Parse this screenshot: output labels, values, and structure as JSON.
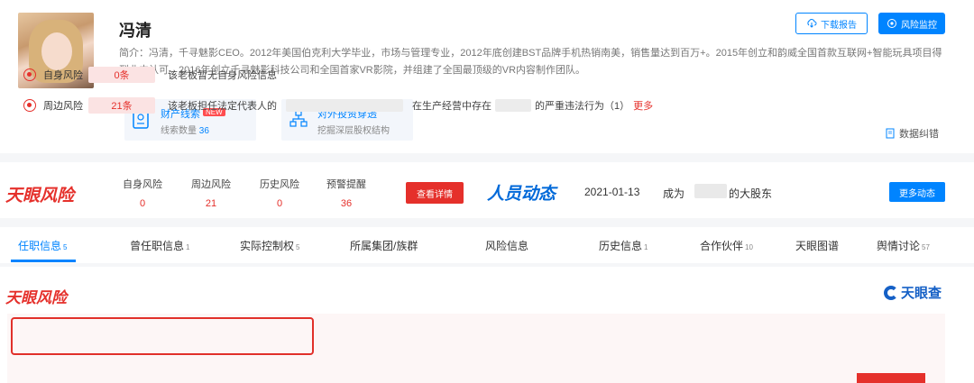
{
  "profile": {
    "name": "冯清",
    "bio": "简介：冯清，千寻魅影CEO。2012年美国伯克利大学毕业，市场与管理专业，2012年底创建BST品牌手机热销南美，销售量达到百万+。2015年创立和韵威全国首款互联网+智能玩具项目得到业内认可。2016年创立千寻魅影科技公司和全国首家VR影院，并组建了全国最顶级的VR内容制作团队。",
    "btn_download": "下载报告",
    "btn_monitor": "风险监控",
    "features": [
      {
        "title": "财产线索",
        "badge": "NEW",
        "sub_prefix": "线索数量",
        "sub_value": "36",
        "icon": "doc-icon"
      },
      {
        "title": "对外投资穿透",
        "sub": "挖掘深层股权结构",
        "icon": "network-icon"
      }
    ],
    "data_correction": "数据纠错"
  },
  "risk_bar": {
    "logo": "天眼风险",
    "stats": [
      {
        "label": "自身风险",
        "value": "0"
      },
      {
        "label": "周边风险",
        "value": "21"
      },
      {
        "label": "历史风险",
        "value": "0"
      },
      {
        "label": "预警提醒",
        "value": "36"
      }
    ],
    "detail_btn": "查看详情",
    "people_title": "人员动态",
    "people_date": "2021-01-13",
    "people_become": "成为",
    "people_shareholder": "的大股东",
    "more_btn": "更多动态"
  },
  "tabs": [
    {
      "label": "任职信息",
      "count": "5"
    },
    {
      "label": "曾任职信息",
      "count": "1"
    },
    {
      "label": "实际控制权",
      "count": "5"
    },
    {
      "label": "所属集团/族群",
      "count": ""
    },
    {
      "label": "风险信息",
      "count": ""
    },
    {
      "label": "历史信息",
      "count": "1"
    },
    {
      "label": "合作伙伴",
      "count": "10"
    },
    {
      "label": "天眼图谱",
      "count": ""
    },
    {
      "label": "舆情讨论",
      "count": "57"
    }
  ],
  "risk_panel": {
    "logo": "天眼风险",
    "brand": "天眼查",
    "rows": [
      {
        "label": "自身风险",
        "count": "0条",
        "text": "该老板暂无自身风险信息"
      },
      {
        "label": "周边风险",
        "count": "21条",
        "text_a": "该老板担任法定代表人的",
        "text_b": "在生产经营中存在",
        "text_c": "的严重违法行为（1）",
        "more": "更多"
      }
    ]
  }
}
